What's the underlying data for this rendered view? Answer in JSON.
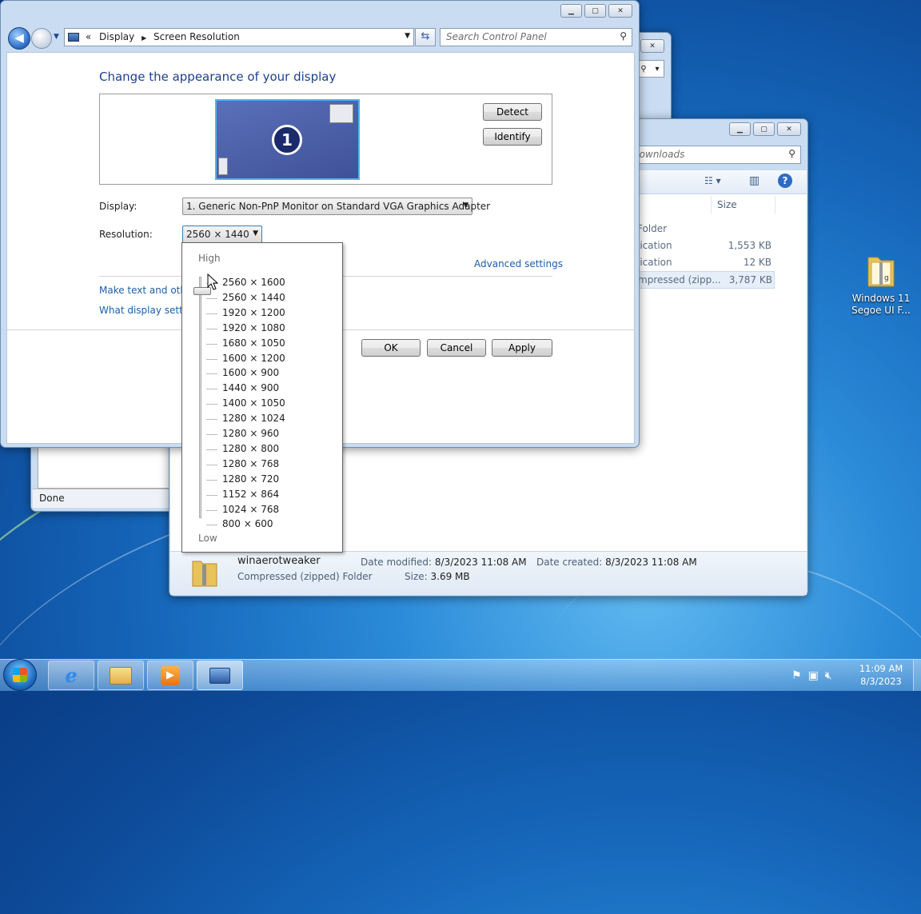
{
  "screen_resolution_window": {
    "breadcrumb": [
      "Display",
      "Screen Resolution"
    ],
    "breadcrumb_prefix": "«",
    "search_placeholder": "Search Control Panel",
    "heading": "Change the appearance of your display",
    "monitor_number": "1",
    "detect_label": "Detect",
    "identify_label": "Identify",
    "display_label": "Display:",
    "display_value": "1. Generic Non-PnP Monitor on Standard VGA Graphics Adapter",
    "resolution_label": "Resolution:",
    "resolution_value": "2560 × 1440",
    "advanced_settings": "Advanced settings",
    "link_text_size": "Make text and other",
    "link_display_settings": "What display setting",
    "ok_label": "OK",
    "cancel_label": "Cancel",
    "apply_label": "Apply"
  },
  "resolution_dropdown": {
    "high_label": "High",
    "low_label": "Low",
    "selected": "2560 × 1440",
    "options": [
      "2560 × 1600",
      "2560 × 1440",
      "1920 × 1200",
      "1920 × 1080",
      "1680 × 1050",
      "1600 × 1200",
      "1600 × 900",
      "1440 × 900",
      "1400 × 1050",
      "1280 × 1024",
      "1280 × 960",
      "1280 × 800",
      "1280 × 768",
      "1280 × 720",
      "1152 × 864",
      "1024 × 768",
      "800 × 600"
    ]
  },
  "downloads_window": {
    "search_placeholder": "n Downloads",
    "size_header": "Size",
    "rows": [
      {
        "type": "Folder",
        "size": ""
      },
      {
        "type": "lication",
        "size": "1,553 KB"
      },
      {
        "type": "lication",
        "size": "12 KB"
      },
      {
        "type": "mpressed (zipp...",
        "size": "3,787 KB"
      }
    ],
    "details": {
      "name": "winaerotweaker",
      "type": "Compressed (zipped) Folder",
      "date_modified_label": "Date modified:",
      "date_modified": "8/3/2023 11:08 AM",
      "date_created_label": "Date created:",
      "date_created": "8/3/2023 11:08 AM",
      "size_label": "Size:",
      "size": "3.69 MB"
    }
  },
  "back_window": {
    "status": "Done"
  },
  "desktop": {
    "icon_label_line1": "Windows 11",
    "icon_label_line2": "Segoe UI F..."
  },
  "taskbar": {
    "time": "11:09 AM",
    "date": "8/3/2023",
    "buttons": [
      "start-orb",
      "internet-explorer",
      "windows-explorer",
      "media-player",
      "control-panel"
    ]
  },
  "colors": {
    "link": "#1a5fad",
    "heading": "#1e3f8f",
    "monitor_blue": "#4a5fa8"
  }
}
